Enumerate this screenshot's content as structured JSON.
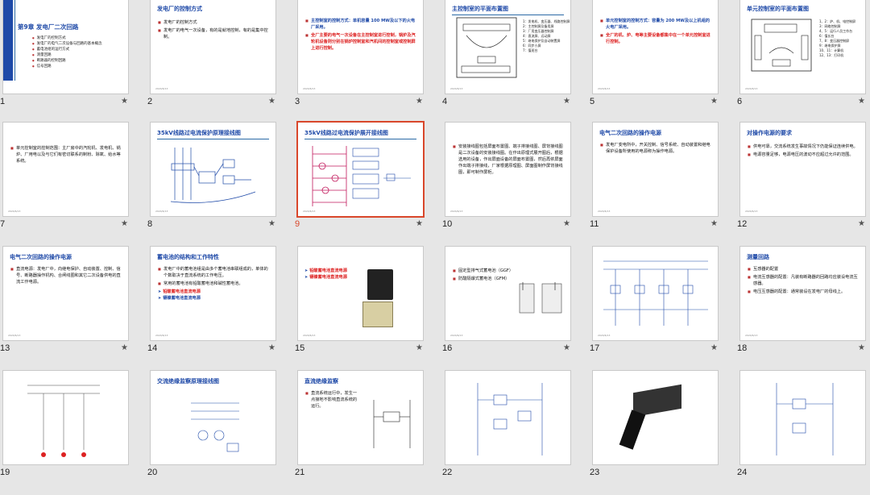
{
  "slides": [
    {
      "num": "1",
      "chapter": "第9章  发电厂二次回路",
      "toc": [
        "发电厂的控制方式",
        "发电厂的电气二次设备与回路的基本概念",
        "蓄电池组的运行方式",
        "测量回路",
        "断路器的控制回路",
        "信号回路"
      ]
    },
    {
      "num": "2",
      "title": "发电厂的控制方式",
      "lines": [
        "发电厂的控制方式",
        "发电厂的电气一次设备，有的是就地控制，有的是集中控制。"
      ]
    },
    {
      "num": "3",
      "lines": [
        "主控制室的控制方式：单机容量 100 MW及以下的火电厂采用。",
        "全厂主要的电气一次设备在主控制室进行控制，锅炉及汽轮机设备则分别在锅炉控制室和汽机间的控制室或控制屏上进行控制。"
      ]
    },
    {
      "num": "4",
      "title": "主控制室的平面布置图",
      "legend": [
        "1：发电机、变压器、线路控制屏",
        "2：主控制屏及备用屏",
        "3：厂用变压器控制屏",
        "4：直流屏、远动屏",
        "5：继电保护及自动装置屏",
        "6：同步小屏",
        "7：值班台"
      ]
    },
    {
      "num": "5",
      "lines": [
        "单元控制室的控制方式：容量为 200 MW及以上机组的火电厂采用。",
        "全厂的机、炉、电等主要设备都集中在一个单元控制室进行控制。"
      ]
    },
    {
      "num": "6",
      "title": "单元控制室的平面布置图",
      "legend": [
        "1、2：炉、机、电控制屏",
        "3：网络控制屏",
        "4、5：运行人员工作台",
        "6：值长台",
        "7、8：变压器控制屏",
        "9：继电保护屏",
        "10、11：计算机",
        "12、13：打印机"
      ]
    },
    {
      "num": "7",
      "lines": [
        "单元控制室的控制范围：主厂房中的汽轮机、发电机、锅炉、厂用电以及与它们有密切联系的制粉、除氧、给水等系统。"
      ]
    },
    {
      "num": "8",
      "title": "35kV线路过电流保护原理接线图"
    },
    {
      "num": "9",
      "title": "35kV线路过电流保护展开接线图"
    },
    {
      "num": "10",
      "lines": [
        "安装接线图包括屏面布置图、端子排接线图、屏背接线图是二次设备的安装接线图。在作出原理式展开图后，根据选用的设备，作出屏面设备的屏面布置图，然后再依屏面作出端子排接线，厂家根据原理图、屏面图制作屏背接线图，即可制作屏柜。"
      ]
    },
    {
      "num": "11",
      "title": "电气二次回路的操作电源",
      "lines": [
        "发电厂变电所中，开关控制、信号系统、自动装置和继电保护设备所使用的电源称为操作电源。"
      ]
    },
    {
      "num": "12",
      "title": "对操作电源的要求",
      "lines": [
        "供电可靠，交流系统发生事故情况下仍能保证连续供电。",
        "电源容量足够，电源电压的波动不应超过允许的范围。"
      ]
    },
    {
      "num": "13",
      "title": "电气二次回路的操作电源",
      "lines": [
        "直流电源：发电厂中，向继电保护、自动装置、控制、信号、断路器操作机构、合闸线圈和其它二次设备供电的直流工作电源。"
      ]
    },
    {
      "num": "14",
      "title": "蓄电池的结构和工作特性",
      "lines": [
        "发电厂中的蓄电池组是由多个蓄电池串联组成的，单体的个数取决于直流系统的工作电压。",
        "常用的蓄电池有铅酸蓄电池和碱性蓄电池。"
      ],
      "arrows": [
        "铅酸蓄电池直流电源",
        "镉镍蓄电池直流电源"
      ]
    },
    {
      "num": "15",
      "arrows": [
        "铅酸蓄电池直流电源",
        "镉镍蓄电池直流电源"
      ]
    },
    {
      "num": "16",
      "lines": [
        "固定型排气式蓄电池（GGF）",
        "防酸隔爆式蓄电池（GFM）"
      ]
    },
    {
      "num": "17"
    },
    {
      "num": "18",
      "title": "测量回路",
      "lines": [
        "互感器的配置",
        "电流互感器的配置：凡装有断路器的回路均应装设电流互感器。",
        "电压互感器的配置：通常装设在发电厂的母线上。"
      ]
    },
    {
      "num": "19"
    },
    {
      "num": "20",
      "title": "交流绝缘监察原理接线图"
    },
    {
      "num": "21",
      "title": "直流绝缘监察",
      "lines": [
        "直流系统运行中，发生一点接地不影响直流系统的运行。"
      ]
    },
    {
      "num": "22"
    },
    {
      "num": "23"
    },
    {
      "num": "24"
    }
  ],
  "footer_text": "2024/6/13",
  "star": "★",
  "selected": "9"
}
